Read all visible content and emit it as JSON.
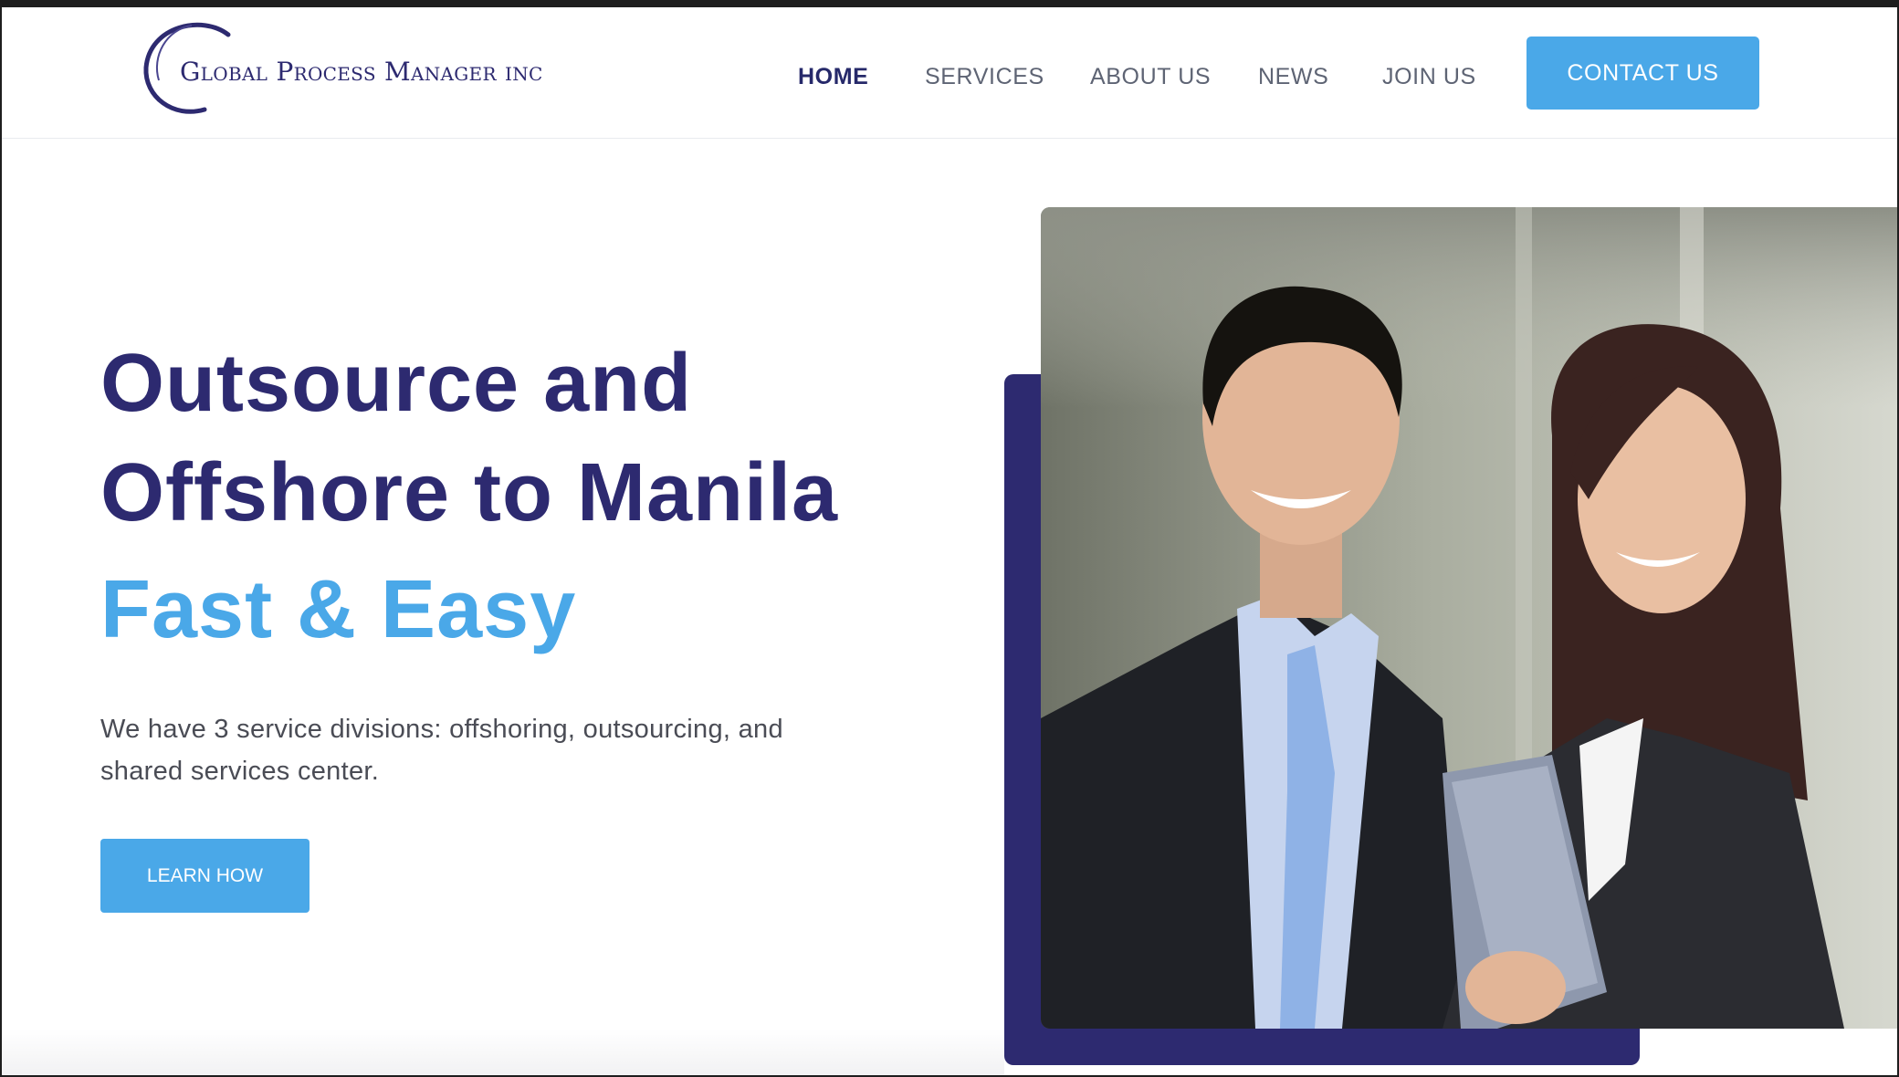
{
  "header": {
    "logo_text": "Global Process Manager inc",
    "nav": [
      {
        "label": "HOME",
        "active": true
      },
      {
        "label": "SERVICES",
        "active": false
      },
      {
        "label": "ABOUT US",
        "active": false
      },
      {
        "label": "NEWS",
        "active": false
      },
      {
        "label": "JOIN US",
        "active": false
      }
    ],
    "contact_label": "CONTACT US"
  },
  "hero": {
    "title_line1": "Outsource and",
    "title_line2": "Offshore to Manila",
    "subtitle": "Fast & Easy",
    "description": "We have 3 service divisions: offshoring, outsourcing, and shared services center.",
    "cta_label": "LEARN HOW",
    "image_alt": "business-people-photo"
  },
  "colors": {
    "brand_navy": "#2d2a70",
    "accent_blue": "#4aa8e8",
    "nav_text": "#5e6474"
  }
}
